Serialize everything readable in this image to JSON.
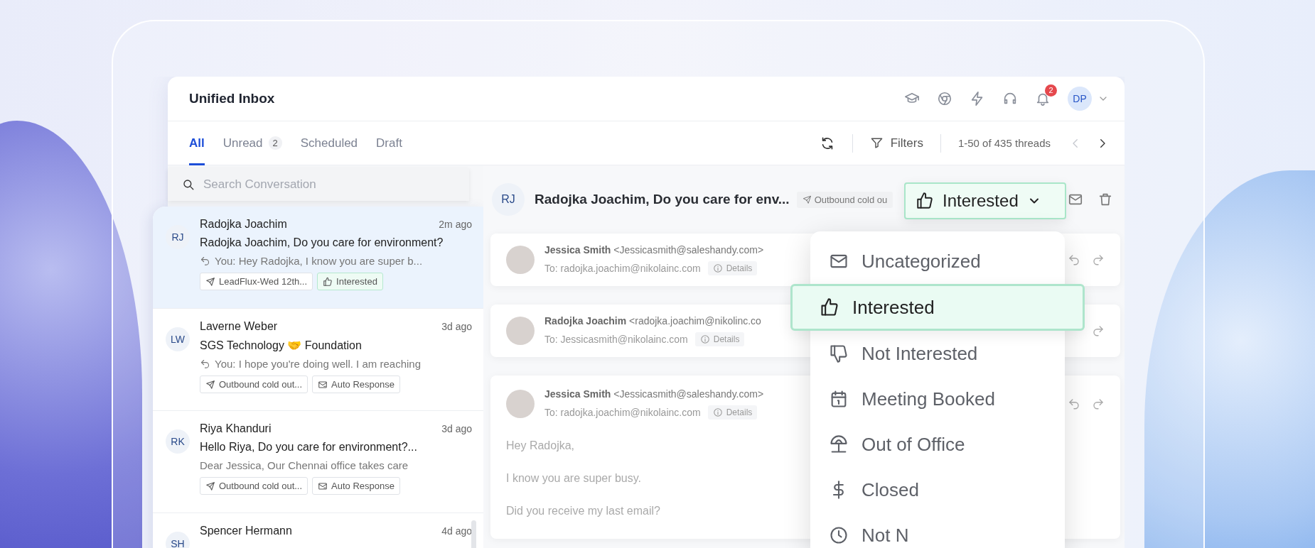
{
  "window": {
    "title": "Unified Inbox"
  },
  "header": {
    "notification_count": "2",
    "user_initials": "DP"
  },
  "tabs": [
    {
      "label": "All",
      "selected": true
    },
    {
      "label": "Unread",
      "count": "2",
      "selected": false
    },
    {
      "label": "Scheduled",
      "selected": false
    },
    {
      "label": "Draft",
      "selected": false
    }
  ],
  "toolbar": {
    "filters_label": "Filters",
    "range": "1-50 of 435 threads"
  },
  "search": {
    "placeholder": "Search Conversation"
  },
  "conversations": [
    {
      "initials": "RJ",
      "name": "Radojka Joachim",
      "time": "2m ago",
      "subject": "Radojka Joachim, Do you care for environment?",
      "preview": "You: Hey Radojka, I know you are super b...",
      "replied": true,
      "selected": true,
      "tags": [
        {
          "kind": "sequence",
          "label": "LeadFlux-Wed 12th..."
        },
        {
          "kind": "interested",
          "label": "Interested"
        }
      ]
    },
    {
      "initials": "LW",
      "name": "Laverne Weber",
      "time": "3d ago",
      "subject": "SGS Technology 🤝 Foundation",
      "preview": "You: I hope you're doing well. I am reaching",
      "replied": true,
      "selected": false,
      "tags": [
        {
          "kind": "sequence",
          "label": "Outbound cold out..."
        },
        {
          "kind": "auto_response",
          "label": "Auto Response"
        }
      ]
    },
    {
      "initials": "RK",
      "name": "Riya Khanduri",
      "time": "3d ago",
      "subject": "Hello Riya, Do you care for environment?...",
      "preview": "Dear Jessica, Our Chennai office takes care",
      "replied": false,
      "selected": false,
      "tags": [
        {
          "kind": "sequence",
          "label": "Outbound cold out..."
        },
        {
          "kind": "auto_response",
          "label": "Auto Response"
        }
      ]
    },
    {
      "initials": "SH",
      "name": "Spencer Hermann",
      "time": "4d ago",
      "selected": false
    }
  ],
  "thread": {
    "initials": "RJ",
    "subject": "Radojka Joachim, Do you care for env...",
    "tag": "Outbound cold ou",
    "category": "Interested",
    "messages": [
      {
        "sender": "Jessica Smith",
        "email": "<Jessicasmith@saleshandy.com>",
        "to": "To: radojka.joachim@nikolainc.com",
        "details": "Details",
        "reply_shown": true
      },
      {
        "sender": "Radojka Joachim",
        "email": "<radojka.joachim@nikolinc.co",
        "to": "To: Jessicasmith@nikolainc.com",
        "details": "Details",
        "reply_shown": false
      },
      {
        "sender": "Jessica Smith",
        "email": "<Jessicasmith@saleshandy.com>",
        "to": "To: radojka.joachim@nikolainc.com",
        "details": "Details",
        "reply_shown": true,
        "body": [
          "Hey Radojka,",
          "I know you are super busy.",
          "Did you receive my last email?"
        ]
      }
    ]
  },
  "category_menu": [
    {
      "kind": "uncategorized",
      "label": "Uncategorized",
      "selected": false
    },
    {
      "kind": "interested",
      "label": "Interested",
      "selected": true
    },
    {
      "kind": "not_interested",
      "label": "Not Interested",
      "selected": false
    },
    {
      "kind": "meeting_booked",
      "label": "Meeting Booked",
      "selected": false
    },
    {
      "kind": "out_of_office",
      "label": "Out of Office",
      "selected": false
    },
    {
      "kind": "closed",
      "label": "Closed",
      "selected": false
    },
    {
      "kind": "not_now",
      "label": "Not N",
      "selected": false
    }
  ]
}
